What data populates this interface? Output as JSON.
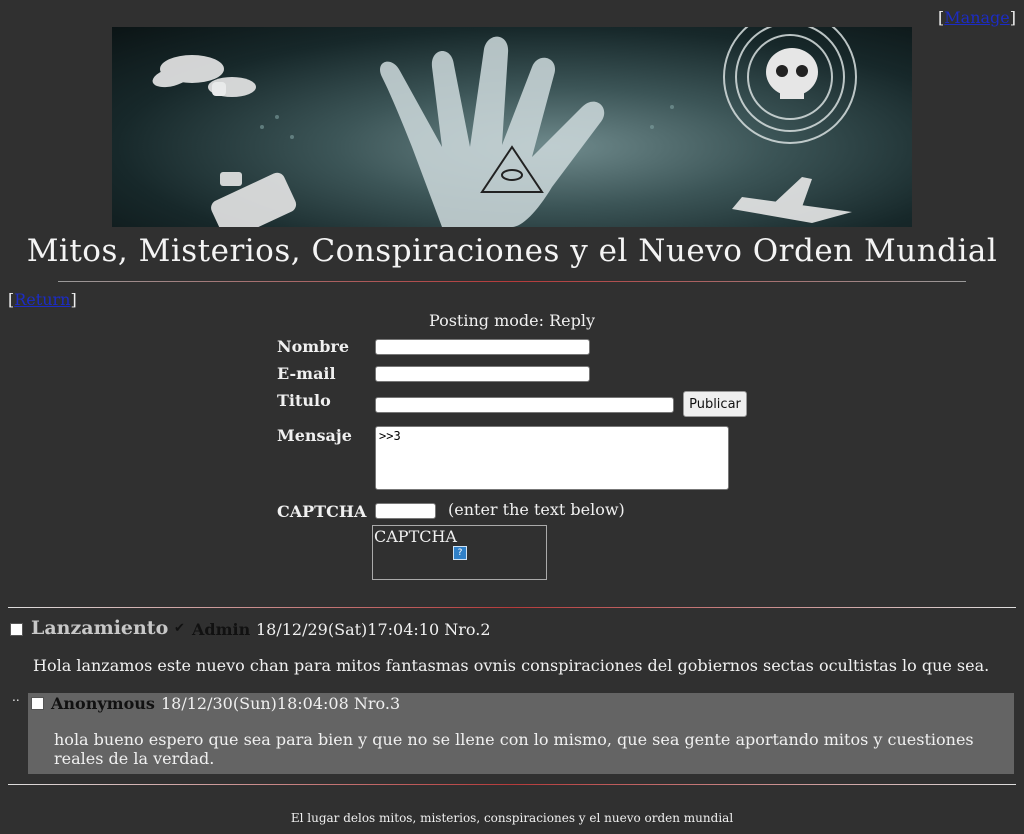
{
  "header": {
    "manage_label": "Manage",
    "title": "Mitos, Misterios, Conspiraciones y el Nuevo Orden Mundial",
    "return_label": "Return"
  },
  "form": {
    "mode_text": "Posting mode: Reply",
    "name_label": "Nombre",
    "name_value": "",
    "email_label": "E-mail",
    "email_value": "",
    "subject_label": "Titulo",
    "subject_value": "",
    "submit_label": "Publicar",
    "message_label": "Mensaje",
    "message_value": ">>3",
    "captcha_label": "CAPTCHA",
    "captcha_value": "",
    "captcha_hint": "(enter the text below)",
    "captcha_image_text": "CAPTCHA",
    "captcha_icon": "?"
  },
  "thread": {
    "op": {
      "subject": "Lanzamiento",
      "admin_mark": "✔",
      "name": "Admin",
      "date": "18/12/29(Sat)17:04:10",
      "number": "Nro.2",
      "body": "Hola lanzamos este nuevo chan para mitos fantasmas ovnis conspiraciones del gobiernos sectas ocultistas lo que sea."
    },
    "reply_marker": "..",
    "replies": [
      {
        "name": "Anonymous",
        "date": "18/12/30(Sun)18:04:08",
        "number": "Nro.3",
        "body": "hola bueno espero que sea para bien y que no se llene con lo mismo, que sea gente aportando mitos y cuestiones reales de la verdad."
      }
    ]
  },
  "footer": {
    "text": "El lugar delos mitos, misterios, conspiraciones y el nuevo orden mundial"
  },
  "colors": {
    "background": "#303030",
    "reply_background": "#646464",
    "link": "#1c2cc4"
  }
}
